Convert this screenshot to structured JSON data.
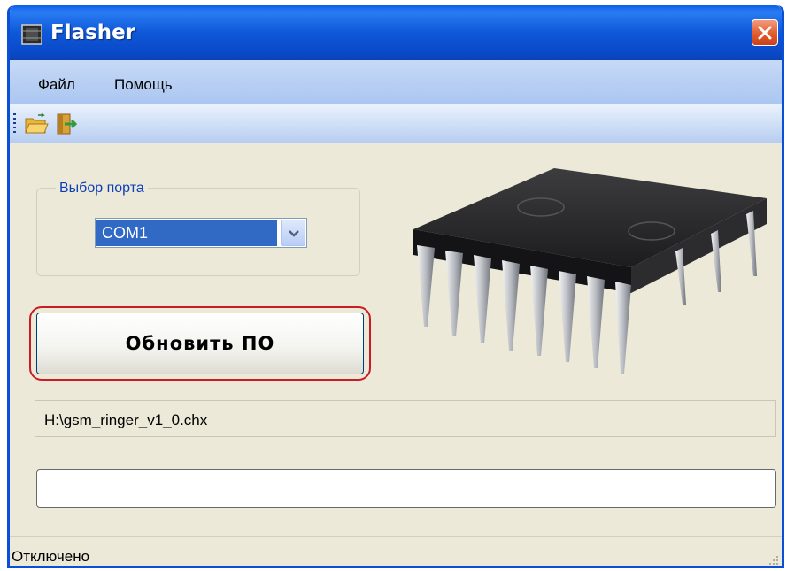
{
  "window": {
    "title": "Flasher",
    "title_icon": "chip-app-icon",
    "close_icon": "close-icon"
  },
  "menu": {
    "items": [
      {
        "label": "Файл"
      },
      {
        "label": "Помощь"
      }
    ]
  },
  "toolbar": {
    "buttons": [
      {
        "icon": "open-folder-icon"
      },
      {
        "icon": "exit-icon"
      }
    ]
  },
  "port_group": {
    "label": "Выбор порта",
    "selected": "COM1"
  },
  "update_button": {
    "label": "Обновить ПО"
  },
  "image": {
    "icon": "microchip-image"
  },
  "file_path": "H:\\gsm_ringer_v1_0.chx",
  "progress": {
    "value": 0
  },
  "status": {
    "text": "Отключено"
  },
  "colors": {
    "accent": "#316ac5",
    "title_bar": "#0a4ac8",
    "highlight_ring": "#c81d25"
  }
}
